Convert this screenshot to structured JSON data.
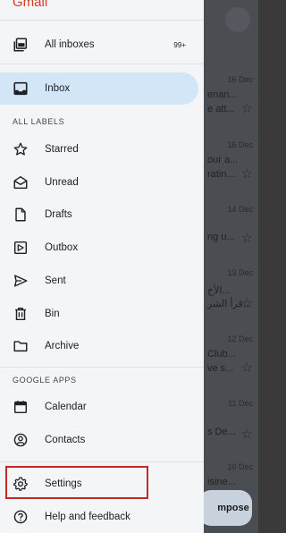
{
  "app": {
    "brand": "Gmail"
  },
  "drawer": {
    "top_items": [
      {
        "label": "All inboxes",
        "badge": "99+",
        "icon": "all-inboxes-icon"
      },
      {
        "label": "Inbox",
        "icon": "inbox-icon",
        "active": true
      }
    ],
    "labels_heading": "ALL LABELS",
    "label_items": [
      {
        "label": "Starred",
        "icon": "star-icon"
      },
      {
        "label": "Unread",
        "icon": "unread-mail-icon"
      },
      {
        "label": "Drafts",
        "icon": "draft-icon"
      },
      {
        "label": "Outbox",
        "icon": "outbox-icon"
      },
      {
        "label": "Sent",
        "icon": "send-icon"
      },
      {
        "label": "Bin",
        "icon": "trash-icon"
      },
      {
        "label": "Archive",
        "icon": "folder-icon"
      }
    ],
    "apps_heading": "GOOGLE APPS",
    "app_items": [
      {
        "label": "Calendar",
        "icon": "calendar-icon"
      },
      {
        "label": "Contacts",
        "icon": "contacts-icon"
      }
    ],
    "bottom_items": [
      {
        "label": "Settings",
        "icon": "gear-icon",
        "highlighted": true
      },
      {
        "label": "Help and feedback",
        "icon": "help-icon"
      }
    ]
  },
  "background": {
    "rows": [
      {
        "date": "16 Dec",
        "line1": "enan...",
        "line2": "e att..."
      },
      {
        "date": "16 Dec",
        "line1": "our a...",
        "line2": "ratin..."
      },
      {
        "date": "14 Dec",
        "line1": "",
        "line2": "ng u..."
      },
      {
        "date": "13 Dec",
        "line1": "الأخ...",
        "line2": "قرأ الشر..."
      },
      {
        "date": "12 Dec",
        "line1": "Club...",
        "line2": "ve s..."
      },
      {
        "date": "11 Dec",
        "line1": "",
        "line2": "s De..."
      },
      {
        "date": "10 Dec",
        "line1": "isine...",
        "line2": ""
      }
    ],
    "compose_label": "mpose"
  },
  "colors": {
    "accent": "#d3e6f8",
    "brand": "#d33a2c",
    "highlight": "#c62828"
  }
}
